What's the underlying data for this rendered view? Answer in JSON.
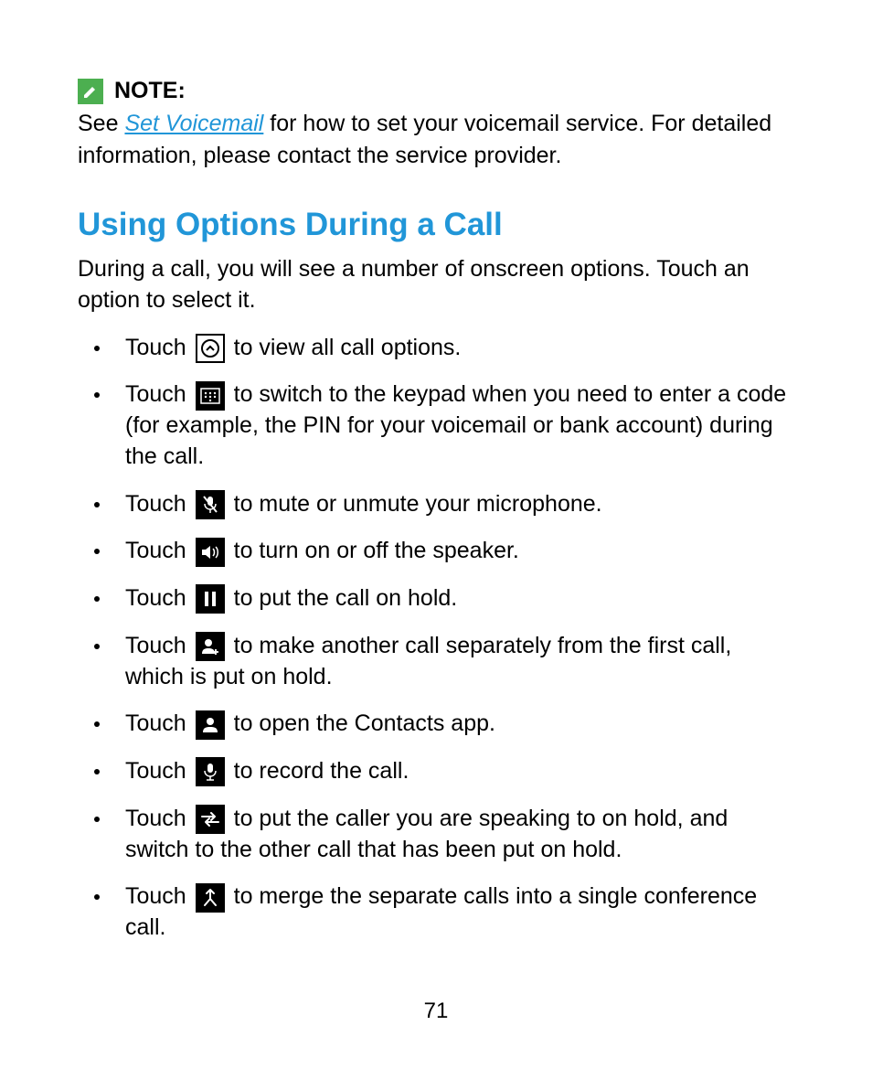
{
  "note": {
    "label": "NOTE:",
    "text_before": "See ",
    "link_text": "Set Voicemail",
    "text_after": " for how to set your voicemail service. For detailed information, please contact the service provider."
  },
  "heading": "Using Options During a Call",
  "intro": "During a call, you will see a number of onscreen options. Touch an option to select it.",
  "items": [
    {
      "prefix": "Touch ",
      "suffix": " to view all call options."
    },
    {
      "prefix": "Touch ",
      "suffix": " to switch to the keypad when you need to enter a code (for example, the PIN for your voicemail or bank account) during the call."
    },
    {
      "prefix": "Touch ",
      "suffix": " to mute or unmute your microphone."
    },
    {
      "prefix": "Touch ",
      "suffix": " to turn on or off the speaker."
    },
    {
      "prefix": "Touch ",
      "suffix": " to put the call on hold."
    },
    {
      "prefix": "Touch ",
      "suffix": " to make another call separately from the first call, which is put on hold."
    },
    {
      "prefix": "Touch ",
      "suffix": " to open the Contacts app."
    },
    {
      "prefix": "Touch ",
      "suffix": " to record the call."
    },
    {
      "prefix": "Touch ",
      "suffix": " to put the caller you are speaking to on hold, and switch to the other call that has been put on hold."
    },
    {
      "prefix": "Touch ",
      "suffix": " to merge the separate calls into a single conference call."
    }
  ],
  "page_number": "71"
}
